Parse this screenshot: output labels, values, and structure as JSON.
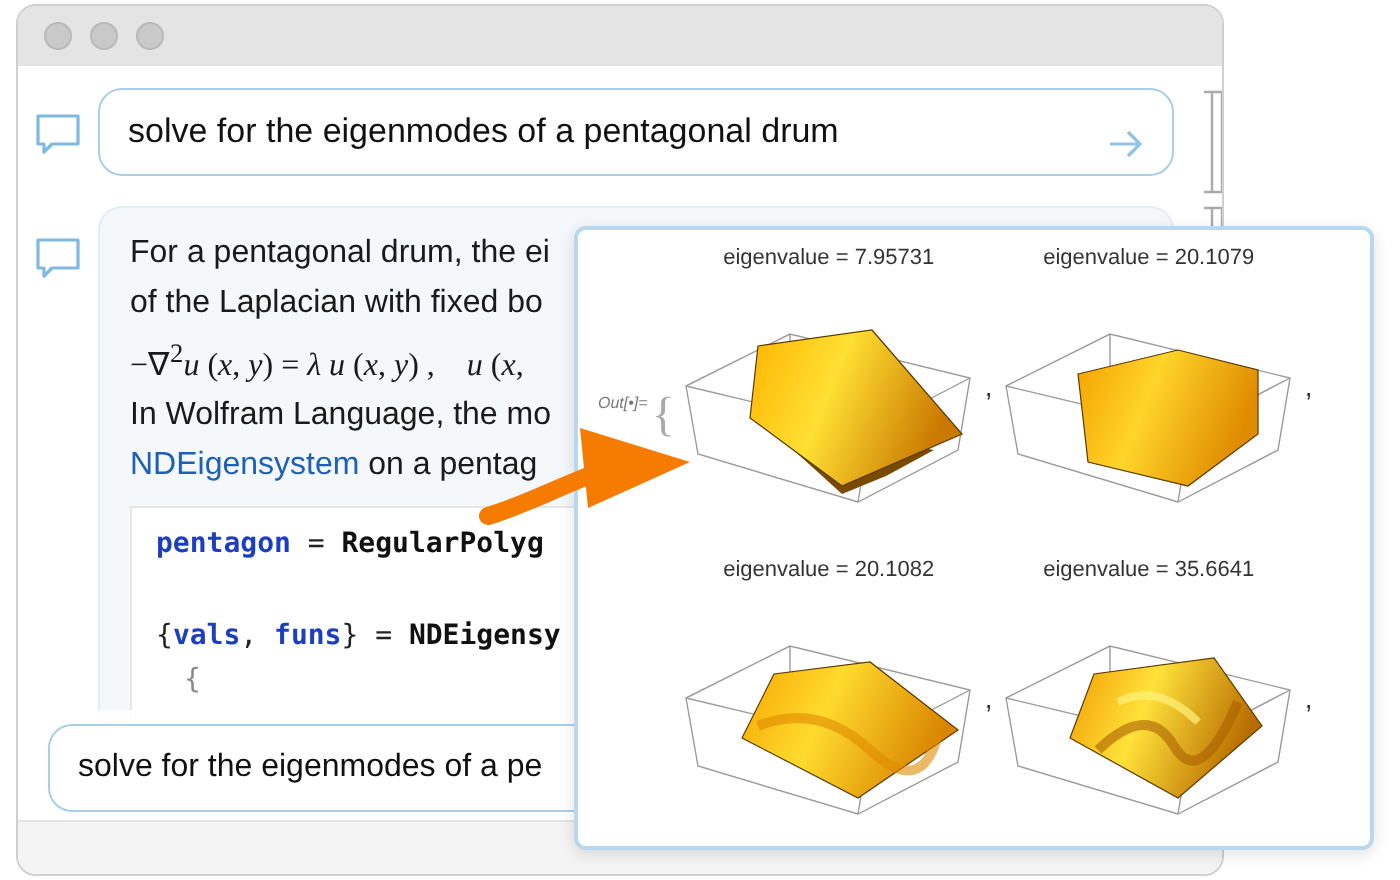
{
  "query": {
    "text": "solve for the eigenmodes of a pentagonal drum"
  },
  "response": {
    "lines": [
      {
        "kind": "text",
        "text": "For a pentagonal drum, the ei"
      },
      {
        "kind": "text",
        "text": "of the Laplacian with fixed bo"
      },
      {
        "kind": "math",
        "text": "−∇$^{2}$*u* (*x*, *y*) = *λ* *u* (*x*, *y*) ,    *u* (*x*,"
      },
      {
        "kind": "text",
        "text": "In Wolfram Language, the mo"
      },
      {
        "kind": "link",
        "link": "NDEigensystem",
        "text": " on a pentag"
      }
    ],
    "code": [
      {
        "tokens": [
          {
            "kind": "symbol",
            "text": "pentagon"
          },
          {
            "kind": "plain",
            "text": " = "
          },
          {
            "kind": "builtin",
            "text": "RegularPolyg"
          }
        ]
      },
      {
        "tokens": [
          {
            "kind": "plain",
            "text": "{"
          },
          {
            "kind": "symbol",
            "text": "vals"
          },
          {
            "kind": "plain",
            "text": ", "
          },
          {
            "kind": "symbol",
            "text": "funs"
          },
          {
            "kind": "plain",
            "text": "} = "
          },
          {
            "kind": "builtin",
            "text": "NDEigensy"
          }
        ]
      },
      {
        "tokens": [
          {
            "kind": "faded",
            "text": "{"
          }
        ]
      }
    ]
  },
  "input": {
    "value": "solve for the eigenmodes of a pe"
  },
  "output": {
    "label": "Out[•]=",
    "open_brace": "{",
    "plots": [
      {
        "title": "eigenvalue = 7.95731",
        "separator": ","
      },
      {
        "title": "eigenvalue = 20.1079",
        "separator": ","
      },
      {
        "title": "eigenvalue = 20.1082",
        "separator": ","
      },
      {
        "title": "eigenvalue = 35.6641",
        "separator": ","
      }
    ]
  }
}
